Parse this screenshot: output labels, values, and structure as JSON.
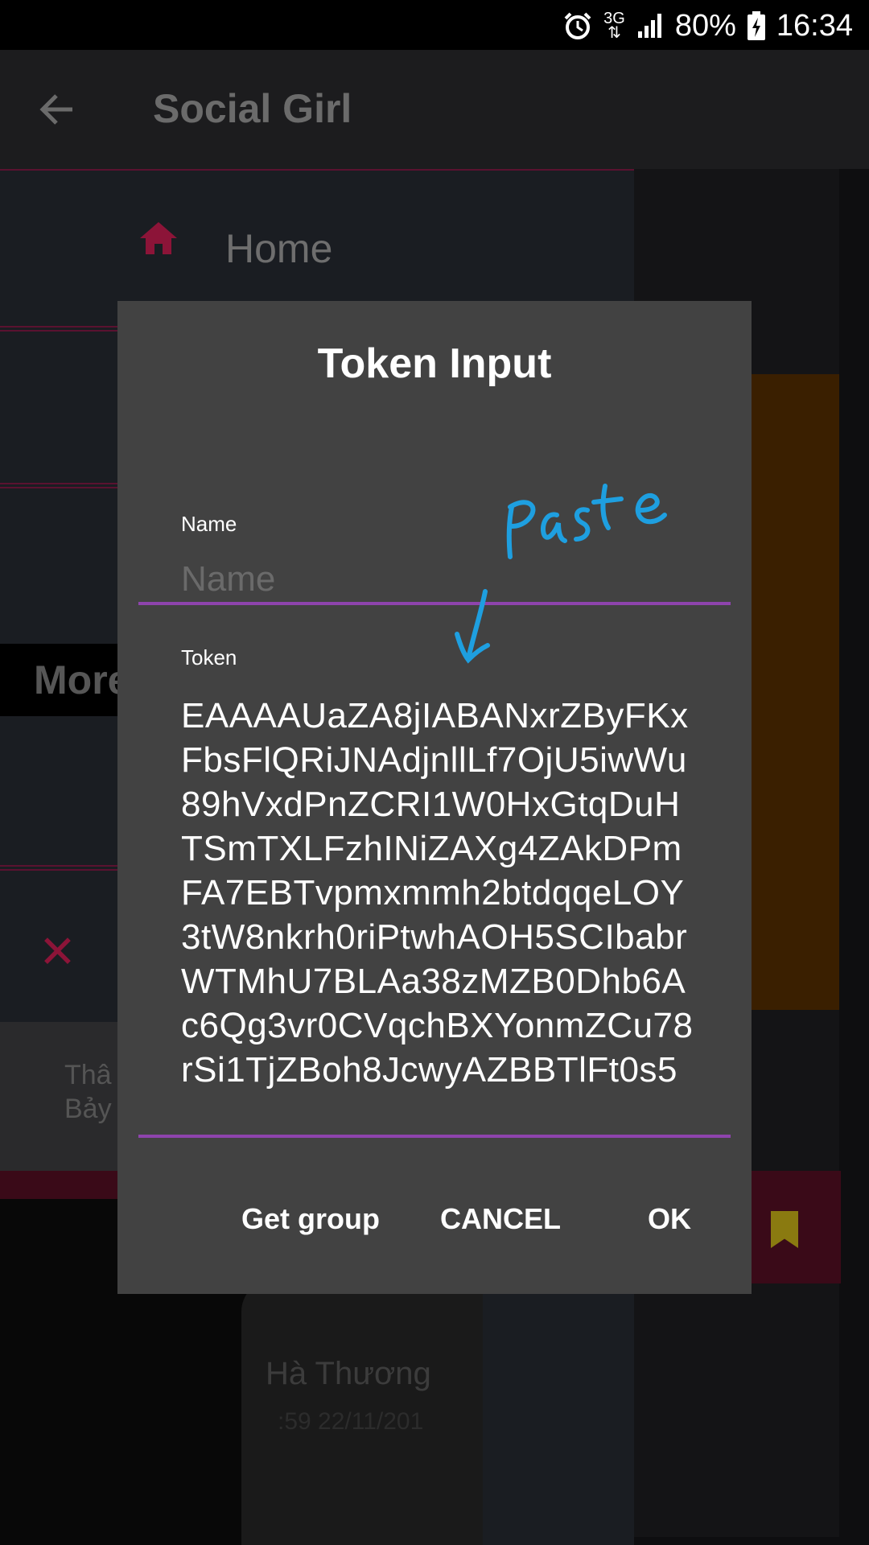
{
  "status_bar": {
    "network": "3G",
    "battery": "80%",
    "time": "16:34"
  },
  "app_bar": {
    "title": "Social Girl"
  },
  "background": {
    "drawer_home_label": "Home",
    "drawer_more_label": "More",
    "card_text_line1": "Thâ",
    "card_text_line2": "Bảy",
    "post_author": "Hà Thương",
    "post_time": ":59 22/11/201"
  },
  "dialog": {
    "title": "Token Input",
    "name_label": "Name",
    "name_placeholder": "Name",
    "name_value": "",
    "token_label": "Token",
    "token_value": "EAAAAUaZA8jIABANxrZByFKxFbsFlQRiJNAdjnllLf7OjU5iwWu89hVxdPnZCRI1W0HxGtqDuHTSmTXLFzhINiZAXg4ZAkDPmFA7EBTvpmxmmh2btdqqeLOY3tW8nkrh0riPtwhAOH5SCIbabrWTMhU7BLAa38zMZB0Dhb6Ac6Qg3vr0CVqchBXYonmZCu78rSi1TjZBoh8JcwyAZBBTlFt0s5",
    "buttons": {
      "get_group": "Get group",
      "cancel": "CANCEL",
      "ok": "OK"
    }
  },
  "annotation": {
    "text": "Paste",
    "color": "#1e9fe0"
  },
  "colors": {
    "accent_underline": "#8e44ad",
    "dialog_bg": "#424242",
    "pink_accent": "#8c1438"
  }
}
